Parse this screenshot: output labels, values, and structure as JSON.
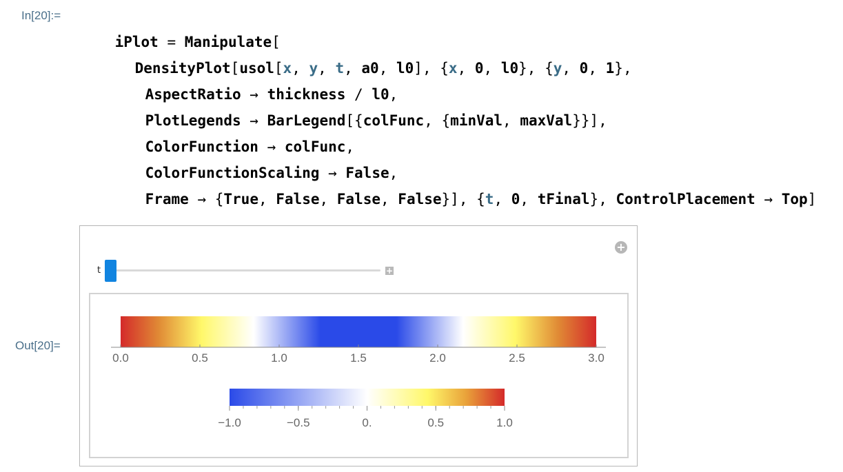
{
  "input_cell": {
    "label": "In[20]:=",
    "lines": [
      [
        "iPlot",
        " = ",
        "Manipulate",
        "["
      ],
      [
        "DensityPlot",
        "[",
        "usol",
        "[",
        "x",
        ", ",
        "y",
        ", ",
        "t",
        ", ",
        "a0",
        ", ",
        "l0",
        "]",
        ", ",
        "{",
        "x",
        ", ",
        "0",
        ", ",
        "l0",
        "}",
        ", ",
        "{",
        "y",
        ", ",
        "0",
        ", ",
        "1",
        "}",
        ","
      ],
      [
        "AspectRatio",
        " → ",
        "thickness",
        " / ",
        "l0",
        ","
      ],
      [
        "PlotLegends",
        " → ",
        "BarLegend",
        "[",
        "{",
        "colFunc",
        ", ",
        "{",
        "minVal",
        ", ",
        "maxVal",
        "}",
        "}",
        "]",
        ","
      ],
      [
        "ColorFunction",
        " → ",
        "colFunc",
        ","
      ],
      [
        "ColorFunctionScaling",
        " → ",
        "False",
        ","
      ],
      [
        "Frame",
        " → ",
        "{",
        "True",
        ", ",
        "False",
        ", ",
        "False",
        ", ",
        "False",
        "}",
        "]",
        ", ",
        "{",
        "t",
        ", ",
        "0",
        ", ",
        "tFinal",
        "}",
        ", ",
        "ControlPlacement",
        " → ",
        "Top",
        "]"
      ]
    ]
  },
  "output_cell": {
    "label": "Out[20]=",
    "manipulate": {
      "control": {
        "variable_label": "t",
        "slider_value": 0.0,
        "expand_icon": "plus-circle-icon",
        "increment_icon": "plus-square-icon"
      },
      "density_plot": {
        "x_range": [
          0,
          3.0
        ],
        "ticks": [
          "0.0",
          "0.5",
          "1.0",
          "1.5",
          "2.0",
          "2.5",
          "3.0"
        ],
        "tick_values": [
          0,
          0.5,
          1.0,
          1.5,
          2.0,
          2.5,
          3.0
        ]
      },
      "bar_legend": {
        "range": [
          -1.0,
          1.0
        ],
        "ticks": [
          "−1.0",
          "−0.5",
          "0.",
          "0.5",
          "1.0"
        ],
        "tick_values": [
          -1.0,
          -0.5,
          0,
          0.5,
          1.0
        ],
        "colors": [
          "#2a4ae8",
          "#ffffff",
          "#fff86a",
          "#e9a23a",
          "#d42a2a"
        ]
      }
    }
  }
}
